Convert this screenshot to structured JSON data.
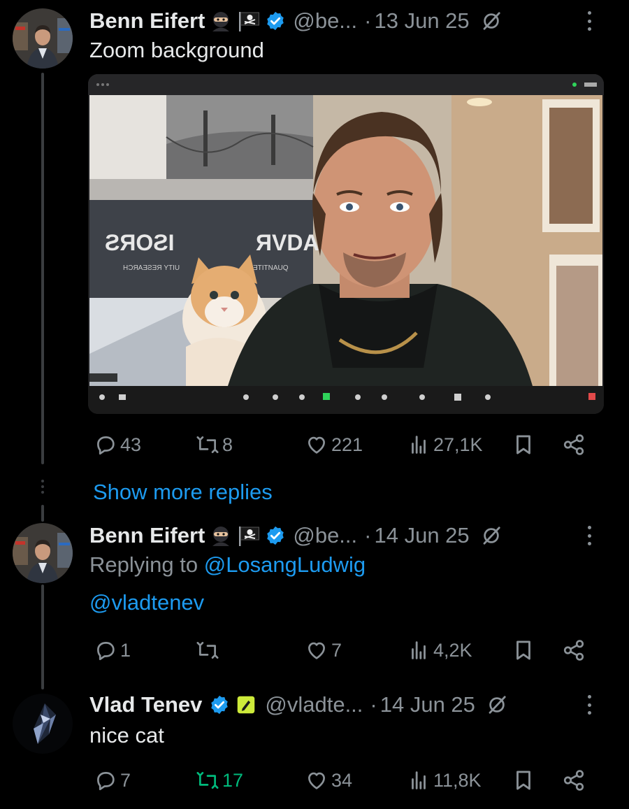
{
  "tweets": [
    {
      "name": "Benn Eifert",
      "handle": "@be...",
      "separator": "·",
      "date": "13 Jun 25",
      "text": "Zoom background",
      "media": {
        "poster_text_1": "ƧЯOƧI",
        "poster_text_2": "ЯVDA",
        "poster_sub_1": "HƆЯAƎƧƎЯ YTIU",
        "poster_sub_2": "ƎTITNAUQ"
      },
      "stats": {
        "replies": "43",
        "reposts": "8",
        "likes": "221",
        "views": "27,1K"
      }
    },
    {
      "name": "Benn Eifert",
      "handle": "@be...",
      "separator": "·",
      "date": "14 Jun 25",
      "replying_prefix": "Replying to ",
      "replying_to": "@LosangLudwig",
      "text": "@vladtenev",
      "stats": {
        "replies": "1",
        "reposts": "",
        "likes": "7",
        "views": "4,2K"
      }
    },
    {
      "name": "Vlad Tenev",
      "handle": "@vladte...",
      "separator": "·",
      "date": "14 Jun 25",
      "text": "nice cat",
      "stats": {
        "replies": "7",
        "reposts": "17",
        "likes": "34",
        "views": "11,8K"
      }
    }
  ],
  "show_more_replies": "Show more replies",
  "colors": {
    "background": "#000000",
    "link": "#1d9bf0",
    "muted": "#8b9298",
    "repost_active": "#00ba7c",
    "verified": "#1d9bf0"
  }
}
